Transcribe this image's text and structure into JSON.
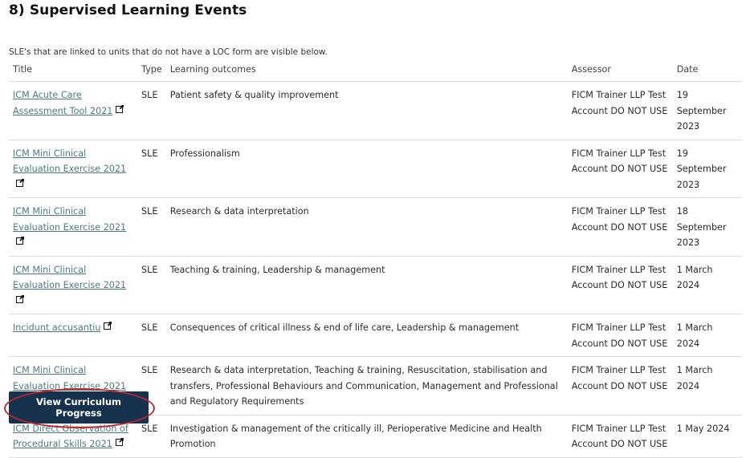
{
  "section": {
    "title": "8) Supervised Learning Events",
    "intro": "SLE's that are linked to units that do not have a LOC form are visible below."
  },
  "table": {
    "headers": {
      "title": "Title",
      "type": "Type",
      "outcomes": "Learning outcomes",
      "assessor": "Assessor",
      "date": "Date"
    },
    "rows": [
      {
        "title": "ICM Acute Care Assessment Tool 2021",
        "type": "SLE",
        "outcomes": "Patient safety & quality improvement",
        "assessor": "FICM Trainer LLP Test Account DO NOT USE",
        "date": "19 September 2023"
      },
      {
        "title": "ICM Mini Clinical Evaluation Exercise 2021",
        "type": "SLE",
        "outcomes": "Professionalism",
        "assessor": "FICM Trainer LLP Test Account DO NOT USE",
        "date": "19 September 2023"
      },
      {
        "title": "ICM Mini Clinical Evaluation Exercise 2021",
        "type": "SLE",
        "outcomes": "Research & data interpretation",
        "assessor": "FICM Trainer LLP Test Account DO NOT USE",
        "date": "18 September 2023"
      },
      {
        "title": "ICM Mini Clinical Evaluation Exercise 2021",
        "type": "SLE",
        "outcomes": "Teaching & training, Leadership & management",
        "assessor": "FICM Trainer LLP Test Account DO NOT USE",
        "date": "1 March 2024"
      },
      {
        "title": "Incidunt accusantiu",
        "type": "SLE",
        "outcomes": "Consequences of critical illness & end of life care, Leadership & management",
        "assessor": "FICM Trainer LLP Test Account DO NOT USE",
        "date": "1 March 2024"
      },
      {
        "title": "ICM Mini Clinical Evaluation Exercise 2021",
        "type": "SLE",
        "outcomes": "Research & data interpretation, Teaching & training, Resuscitation, stabilisation and transfers, Professional Behaviours and Communication, Management and Professional and Regulatory Requirements",
        "assessor": "FICM Trainer LLP Test Account DO NOT USE",
        "date": "1 March 2024"
      },
      {
        "title": "ICM Direct Observation of Procedural Skills 2021",
        "type": "SLE",
        "outcomes": "Investigation & management of the critically ill, Perioperative Medicine and Health Promotion",
        "assessor": "FICM Trainer LLP Test Account DO NOT USE",
        "date": "1 May 2024"
      }
    ],
    "link_icon": "external-link-icon"
  },
  "actions": {
    "view_progress_label": "View Curriculum Progress"
  },
  "colors": {
    "link": "#4d7a82",
    "button_bg": "#17324d",
    "highlight_ring": "#c0272d"
  }
}
